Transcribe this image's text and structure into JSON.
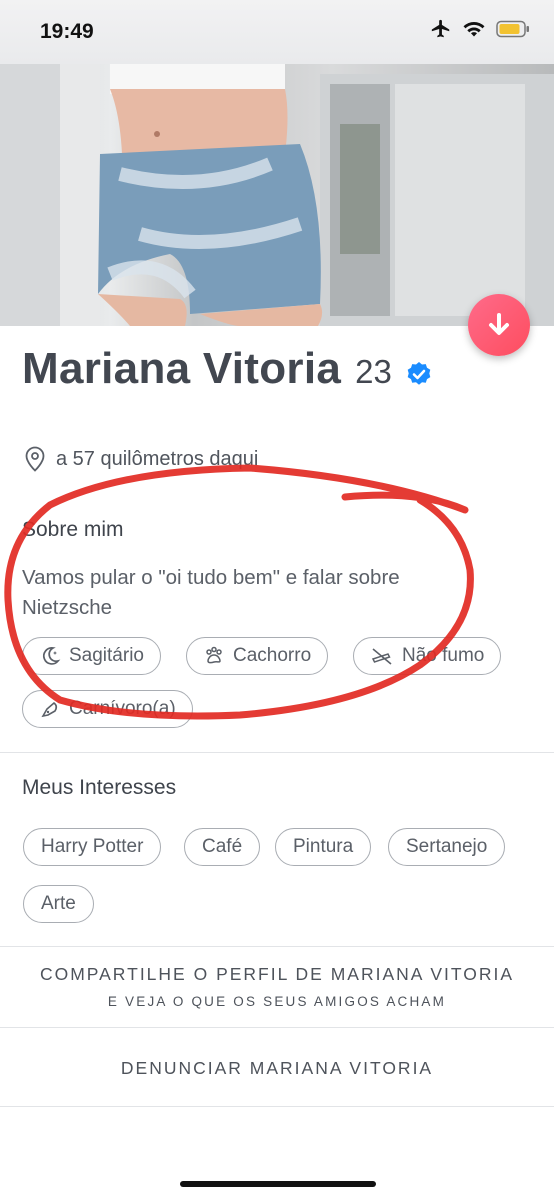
{
  "status_bar": {
    "time": "19:49"
  },
  "profile": {
    "name": "Mariana Vitoria",
    "age": "23",
    "distance": "a 57 quilômetros daqui"
  },
  "about": {
    "title": "Sobre mim",
    "bio": "Vamos pular o \"oi tudo bem\" e falar sobre Nietzsche",
    "tags": [
      "Sagitário",
      "Cachorro",
      "Não fumo",
      "Carnívoro(a)"
    ]
  },
  "interests": {
    "title": "Meus Interesses",
    "items": [
      "Harry Potter",
      "Café",
      "Pintura",
      "Sertanejo",
      "Arte"
    ]
  },
  "share": {
    "title": "COMPARTILHE O PERFIL DE MARIANA VITORIA",
    "subtitle": "E VEJA O QUE OS SEUS AMIGOS ACHAM"
  },
  "report": {
    "label": "DENUNCIAR MARIANA VITORIA"
  },
  "colors": {
    "accent": "#fd5068",
    "verified": "#1a8cff",
    "annotation": "#e22a23"
  }
}
